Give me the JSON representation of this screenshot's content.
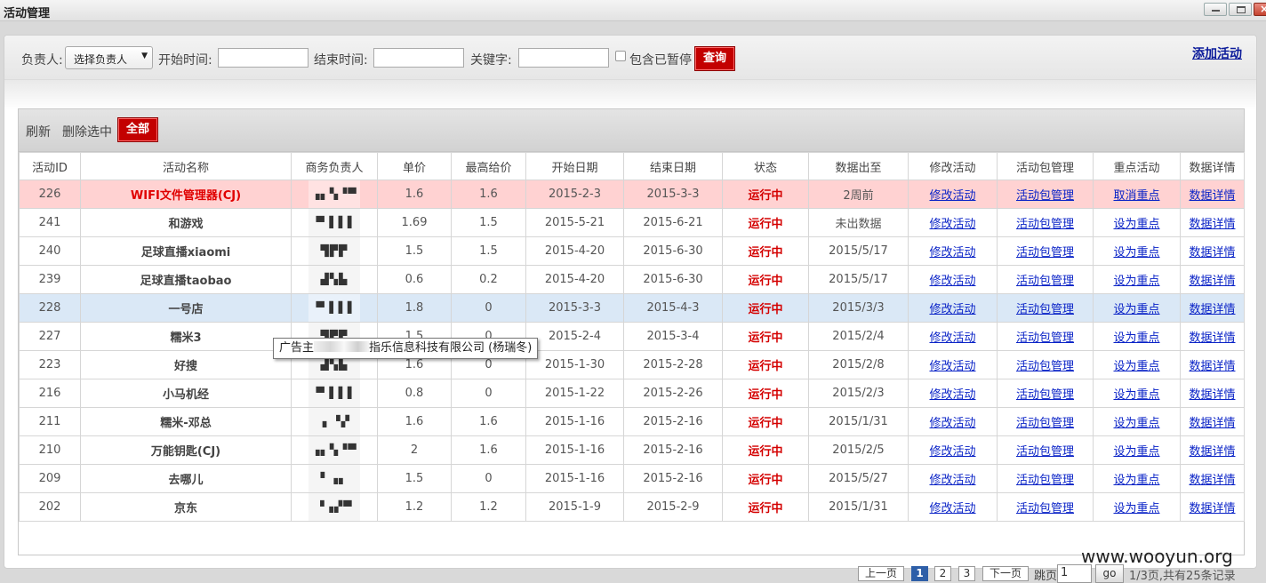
{
  "window": {
    "title": "活动管理"
  },
  "search": {
    "owner_label": "负责人:",
    "owner_select": "选择负责人",
    "start_label": "开始时间:",
    "end_label": "结束时间:",
    "keyword_label": "关键字:",
    "include_paused": "包含已暂停",
    "query_btn": "查询",
    "add_link": "添加活动"
  },
  "grid_toolbar": {
    "refresh": "刷新",
    "delete_selected": "删除选中",
    "all": "全部"
  },
  "columns": [
    "活动ID",
    "活动名称",
    "商务负责人",
    "单价",
    "最高给价",
    "开始日期",
    "结束日期",
    "状态",
    "数据出至",
    "修改活动",
    "活动包管理",
    "重点活动",
    "数据详情"
  ],
  "rows": [
    {
      "id": "226",
      "name": "WIFI文件管理器(CJ)",
      "mgr": "▗▖▚▝▀",
      "price": "1.6",
      "max": "1.6",
      "start": "2015-2-3",
      "end": "2015-3-3",
      "status": "运行中",
      "data_to": "2周前",
      "edit": "修改活动",
      "pkg": "活动包管理",
      "focus": "取消重点",
      "detail": "数据详情",
      "style": "pink"
    },
    {
      "id": "241",
      "name": "和游戏",
      "mgr": "▀▐▐▐",
      "price": "1.69",
      "max": "1.5",
      "start": "2015-5-21",
      "end": "2015-6-21",
      "status": "运行中",
      "data_to": "未出数据",
      "edit": "修改活动",
      "pkg": "活动包管理",
      "focus": "设为重点",
      "detail": "数据详情",
      "style": ""
    },
    {
      "id": "240",
      "name": "足球直播xiaomi",
      "mgr": "▜▛▛",
      "price": "1.5",
      "max": "1.5",
      "start": "2015-4-20",
      "end": "2015-6-30",
      "status": "运行中",
      "data_to": "2015/5/17",
      "edit": "修改活动",
      "pkg": "活动包管理",
      "focus": "设为重点",
      "detail": "数据详情",
      "style": ""
    },
    {
      "id": "239",
      "name": "足球直播taobao",
      "mgr": "▟▚▙",
      "price": "0.6",
      "max": "0.2",
      "start": "2015-4-20",
      "end": "2015-6-30",
      "status": "运行中",
      "data_to": "2015/5/17",
      "edit": "修改活动",
      "pkg": "活动包管理",
      "focus": "设为重点",
      "detail": "数据详情",
      "style": ""
    },
    {
      "id": "228",
      "name": "一号店",
      "mgr": "▀▐▐▐",
      "price": "1.8",
      "max": "0",
      "start": "2015-3-3",
      "end": "2015-4-3",
      "status": "运行中",
      "data_to": "2015/3/3",
      "edit": "修改活动",
      "pkg": "活动包管理",
      "focus": "设为重点",
      "detail": "数据详情",
      "style": "blue"
    },
    {
      "id": "227",
      "name": "糯米3",
      "mgr": "▜▛▛",
      "price": "1.5",
      "max": "0",
      "start": "2015-2-4",
      "end": "2015-3-4",
      "status": "运行中",
      "data_to": "2015/2/4",
      "edit": "修改活动",
      "pkg": "活动包管理",
      "focus": "设为重点",
      "detail": "数据详情",
      "style": ""
    },
    {
      "id": "223",
      "name": "好搜",
      "mgr": "▟▚▙",
      "price": "1.6",
      "max": "0",
      "start": "2015-1-30",
      "end": "2015-2-28",
      "status": "运行中",
      "data_to": "2015/2/8",
      "edit": "修改活动",
      "pkg": "活动包管理",
      "focus": "设为重点",
      "detail": "数据详情",
      "style": ""
    },
    {
      "id": "216",
      "name": "小马机经",
      "mgr": "▀▐▐▐",
      "price": "0.8",
      "max": "0",
      "start": "2015-1-22",
      "end": "2015-2-26",
      "status": "运行中",
      "data_to": "2015/2/3",
      "edit": "修改活动",
      "pkg": "活动包管理",
      "focus": "设为重点",
      "detail": "数据详情",
      "style": ""
    },
    {
      "id": "211",
      "name": "糯米-邓总",
      "mgr": "▗ ▝▞",
      "price": "1.6",
      "max": "1.6",
      "start": "2015-1-16",
      "end": "2015-2-16",
      "status": "运行中",
      "data_to": "2015/1/31",
      "edit": "修改活动",
      "pkg": "活动包管理",
      "focus": "设为重点",
      "detail": "数据详情",
      "style": ""
    },
    {
      "id": "210",
      "name": "万能钥匙(CJ)",
      "mgr": "▗▖▚▝▀",
      "price": "2",
      "max": "1.6",
      "start": "2015-1-16",
      "end": "2015-2-16",
      "status": "运行中",
      "data_to": "2015/2/5",
      "edit": "修改活动",
      "pkg": "活动包管理",
      "focus": "设为重点",
      "detail": "数据详情",
      "style": ""
    },
    {
      "id": "209",
      "name": "去哪儿",
      "mgr": "▘▗▖",
      "price": "1.5",
      "max": "0",
      "start": "2015-1-16",
      "end": "2015-2-16",
      "status": "运行中",
      "data_to": "2015/5/27",
      "edit": "修改活动",
      "pkg": "活动包管理",
      "focus": "设为重点",
      "detail": "数据详情",
      "style": ""
    },
    {
      "id": "202",
      "name": "京东",
      "mgr": "▝▗▞▀",
      "price": "1.2",
      "max": "1.2",
      "start": "2015-1-9",
      "end": "2015-2-9",
      "status": "运行中",
      "data_to": "2015/1/31",
      "edit": "修改活动",
      "pkg": "活动包管理",
      "focus": "设为重点",
      "detail": "数据详情",
      "style": ""
    }
  ],
  "tooltip": {
    "prefix": "广告主",
    "suffix": "指乐信息科技有限公司 (杨瑞冬)"
  },
  "pager": {
    "prev": "上一页",
    "pages": [
      "1",
      "2",
      "3"
    ],
    "current": "1",
    "next": "下一页",
    "jump_label": "跳页",
    "jump_value": "1",
    "go": "go",
    "summary": "1/3页,共有25条记录"
  },
  "watermark": "www.wooyun.org"
}
